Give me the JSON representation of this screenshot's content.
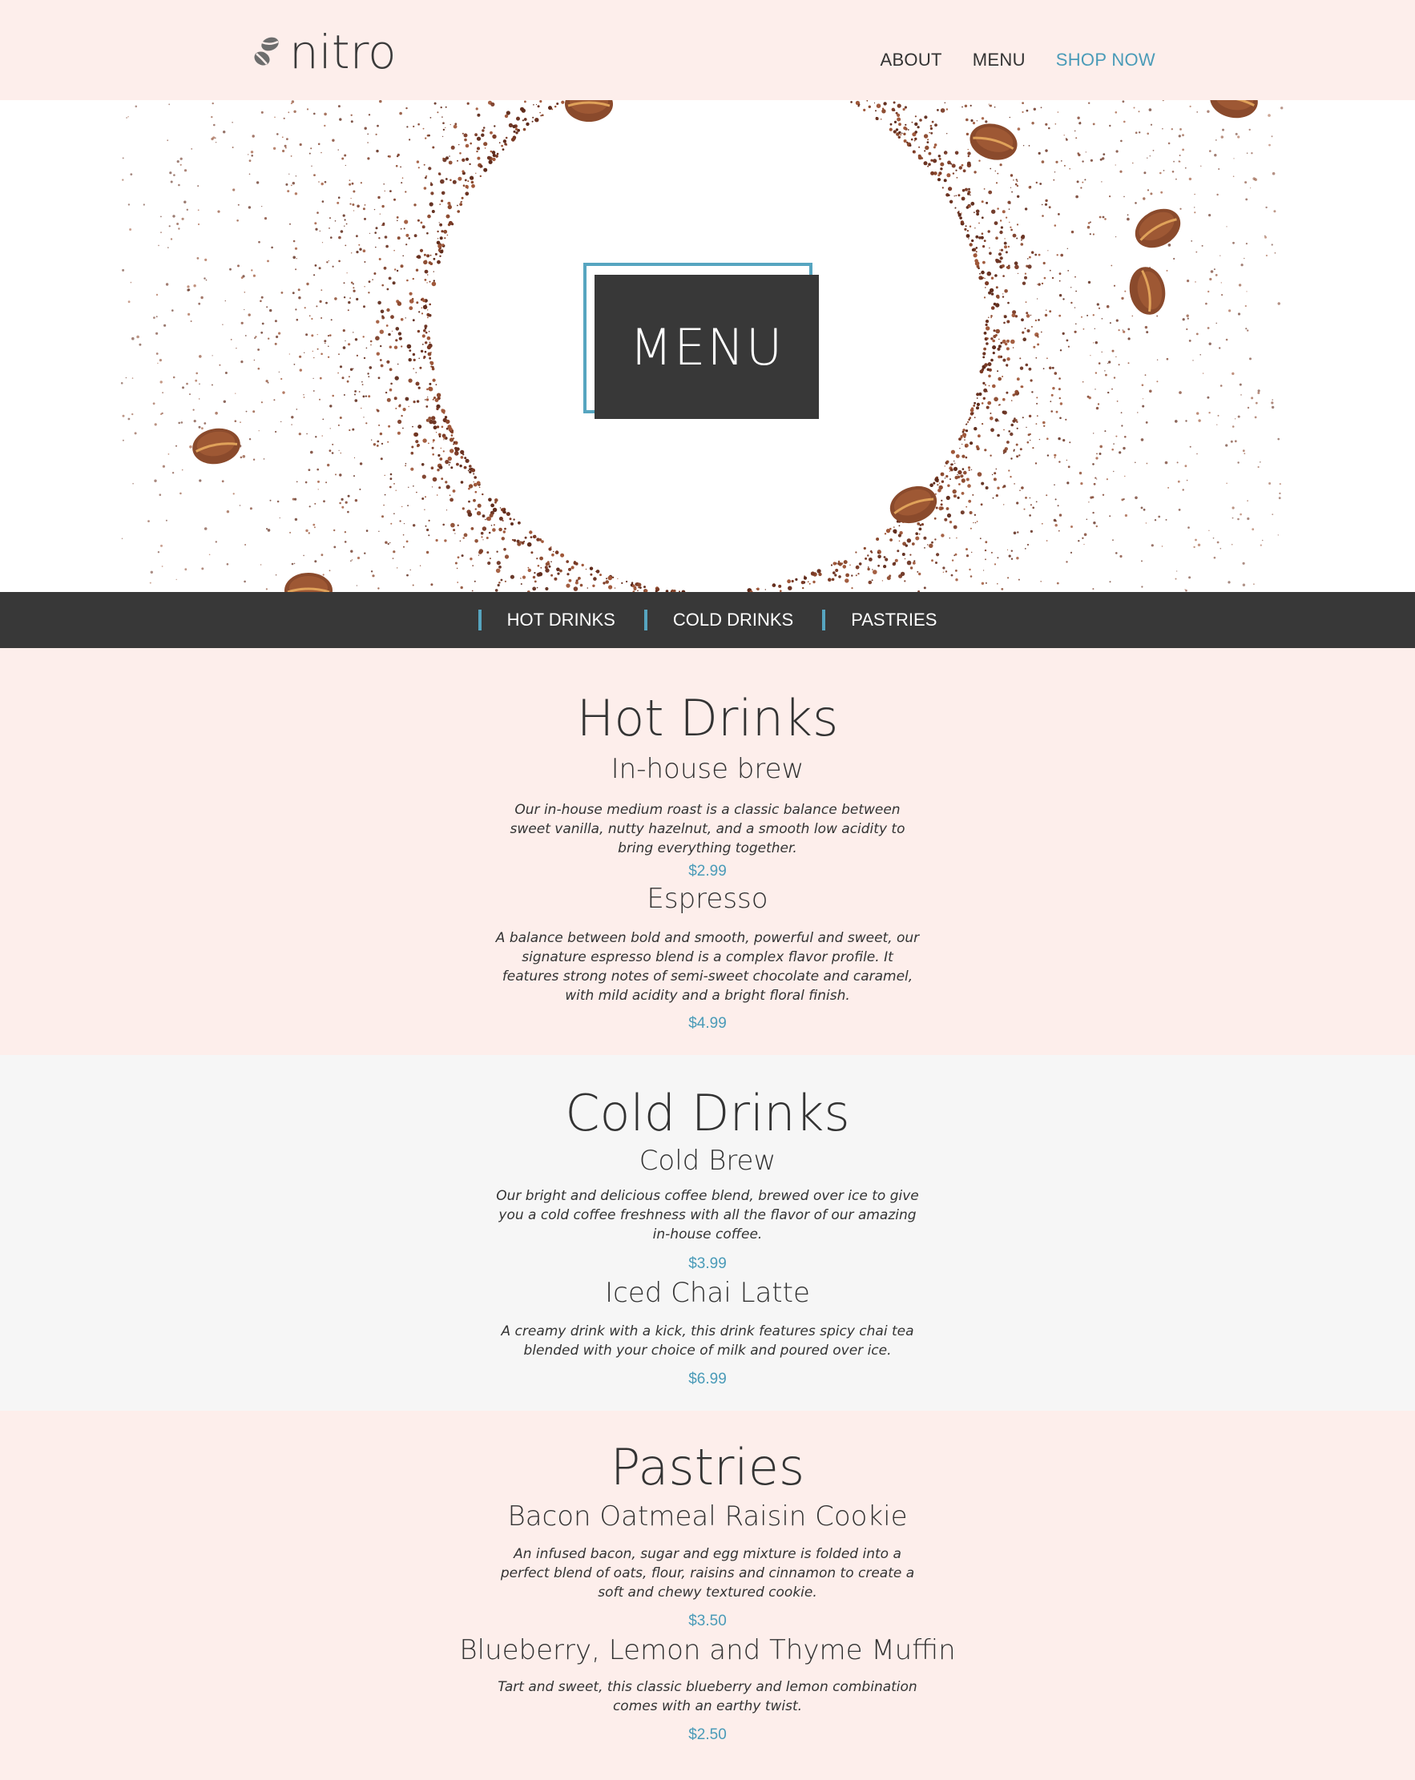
{
  "header": {
    "logo_text": "nitro",
    "nav": [
      {
        "label": "ABOUT"
      },
      {
        "label": "MENU"
      },
      {
        "label": "SHOP NOW"
      }
    ]
  },
  "hero": {
    "badge_label": "MENU"
  },
  "subnav": [
    {
      "label": "HOT DRINKS"
    },
    {
      "label": "COLD DRINKS"
    },
    {
      "label": "PASTRIES"
    }
  ],
  "sections": {
    "hot": {
      "title": "Hot Drinks",
      "items": [
        {
          "name": "In-house brew",
          "description": "Our in-house medium roast is a classic balance between sweet vanilla, nutty hazelnut, and a smooth low acidity to bring everything together.",
          "price": "$2.99"
        },
        {
          "name": "Espresso",
          "description": "A balance between bold and smooth, powerful and sweet, our signature espresso blend is a complex flavor profile. It features strong notes of semi-sweet chocolate and caramel, with mild acidity and a bright floral finish.",
          "price": "$4.99"
        }
      ]
    },
    "cold": {
      "title": "Cold Drinks",
      "items": [
        {
          "name": "Cold Brew",
          "description": "Our bright and delicious coffee blend, brewed over ice to give you a cold coffee freshness with all the flavor of our amazing in-house coffee.",
          "price": "$3.99"
        },
        {
          "name": "Iced Chai Latte",
          "description": "A creamy drink with a kick, this drink features spicy chai tea blended with your choice of milk and poured over ice.",
          "price": "$6.99"
        }
      ]
    },
    "pastries": {
      "title": "Pastries",
      "items": [
        {
          "name": "Bacon Oatmeal Raisin Cookie",
          "description": "An infused bacon, sugar and egg mixture is folded into a perfect blend of oats, flour, raisins and cinnamon to create a soft and chewy textured cookie.",
          "price": "$3.50"
        },
        {
          "name": "Blueberry, Lemon and Thyme Muffin",
          "description": "Tart and sweet, this classic blueberry and lemon combination comes with an earthy twist.",
          "price": "$2.50"
        }
      ]
    }
  },
  "colors": {
    "background_pink": "#fdeeeb",
    "background_gray": "#f6f6f6",
    "dark": "#383838",
    "accent": "#4a9bb8"
  },
  "icons": [
    "coffee-beans-logo-icon"
  ]
}
